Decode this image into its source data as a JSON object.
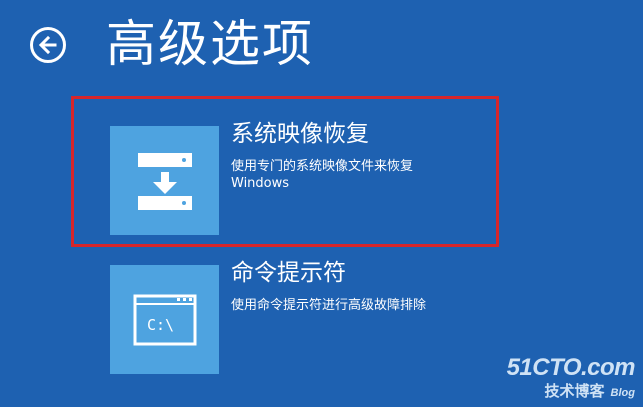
{
  "header": {
    "back_icon": "arrow-left-icon",
    "title": "高级选项"
  },
  "options": [
    {
      "icon": "system-image-restore-icon",
      "title": "系统映像恢复",
      "description_line1": "使用专门的系统映像文件来恢复",
      "description_line2": "Windows",
      "highlighted": true,
      "highlight_color": "#d7262b"
    },
    {
      "icon": "command-prompt-icon",
      "title": "命令提示符",
      "description_line1": "使用命令提示符进行高级故障排除",
      "icon_text": "C:\\"
    }
  ],
  "watermark": {
    "main": "51CTO.com",
    "sub": "技术博客",
    "blog": "Blog"
  },
  "colors": {
    "background": "#1e61b1",
    "tile": "#4ea3e0",
    "text": "#ffffff"
  }
}
